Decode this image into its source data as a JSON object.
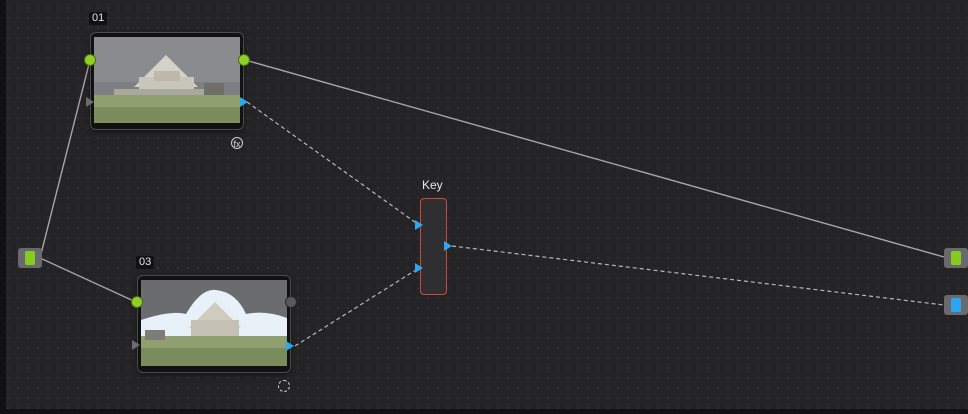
{
  "nodes": [
    {
      "id": "01",
      "label": "01",
      "badge": "fx"
    },
    {
      "id": "03",
      "label": "03",
      "badge": ""
    }
  ],
  "key_node": {
    "label": "Key"
  },
  "colors": {
    "background": "#242427",
    "rgb_port": "#8fcf26",
    "alpha_port": "#2ea7ee",
    "key_border": "#d2473c",
    "link": "#a6a6aa"
  },
  "icons": {
    "fx_badge": "fx-icon",
    "tracker_badge": "dashed-circle-icon"
  }
}
